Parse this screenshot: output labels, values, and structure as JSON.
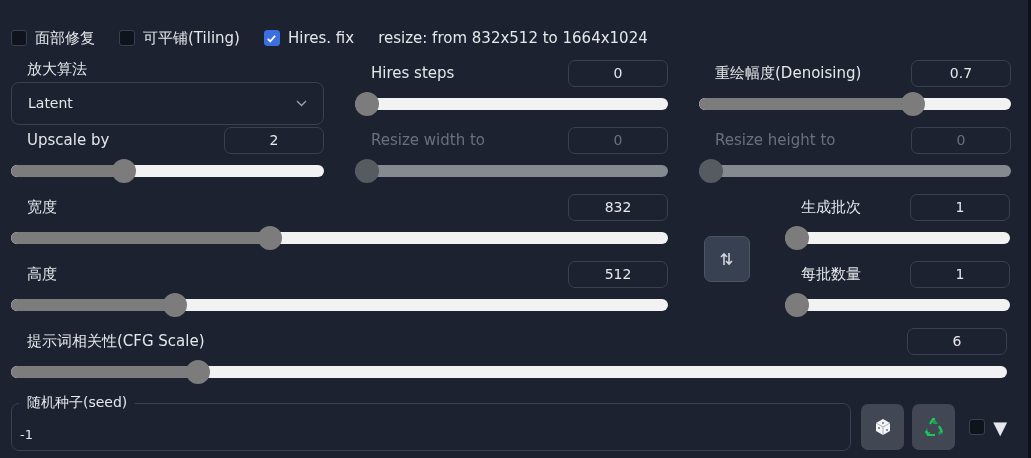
{
  "checkboxes": [
    {
      "label": "面部修复",
      "checked": false
    },
    {
      "label": "可平铺(Tiling)",
      "checked": false
    },
    {
      "label": "Hires. fix",
      "checked": true
    }
  ],
  "resize_info": "resize: from 832x512 to 1664x1024",
  "hires": {
    "upscaler": {
      "label": "放大算法",
      "value": "Latent"
    },
    "sliders": [
      {
        "label": "Hires steps",
        "value": "0",
        "level": 0,
        "disabled": false
      },
      {
        "label": "重绘幅度(Denoising)",
        "value": "0.7",
        "level": 0.7,
        "disabled": false
      },
      {
        "label": "Upscale by",
        "value": "2",
        "level": 0.35,
        "disabled": false
      },
      {
        "label": "Resize width to",
        "value": "0",
        "level": 0,
        "disabled": true
      },
      {
        "label": "Resize height to",
        "value": "0",
        "level": 0,
        "disabled": true
      }
    ]
  },
  "size": [
    {
      "label": "宽度",
      "value": "832",
      "level": 0.39
    },
    {
      "label": "高度",
      "value": "512",
      "level": 0.24
    }
  ],
  "batch": [
    {
      "label": "生成批次",
      "value": "1",
      "level": 0
    },
    {
      "label": "每批数量",
      "value": "1",
      "level": 0
    }
  ],
  "cfg": {
    "label": "提示词相关性(CFG Scale)",
    "value": "6",
    "level": 0.18
  },
  "seed": {
    "label": "随机种子(seed)",
    "value": "-1"
  },
  "extra_checkbox": {
    "checked": false
  },
  "extra_toggle": "▼"
}
